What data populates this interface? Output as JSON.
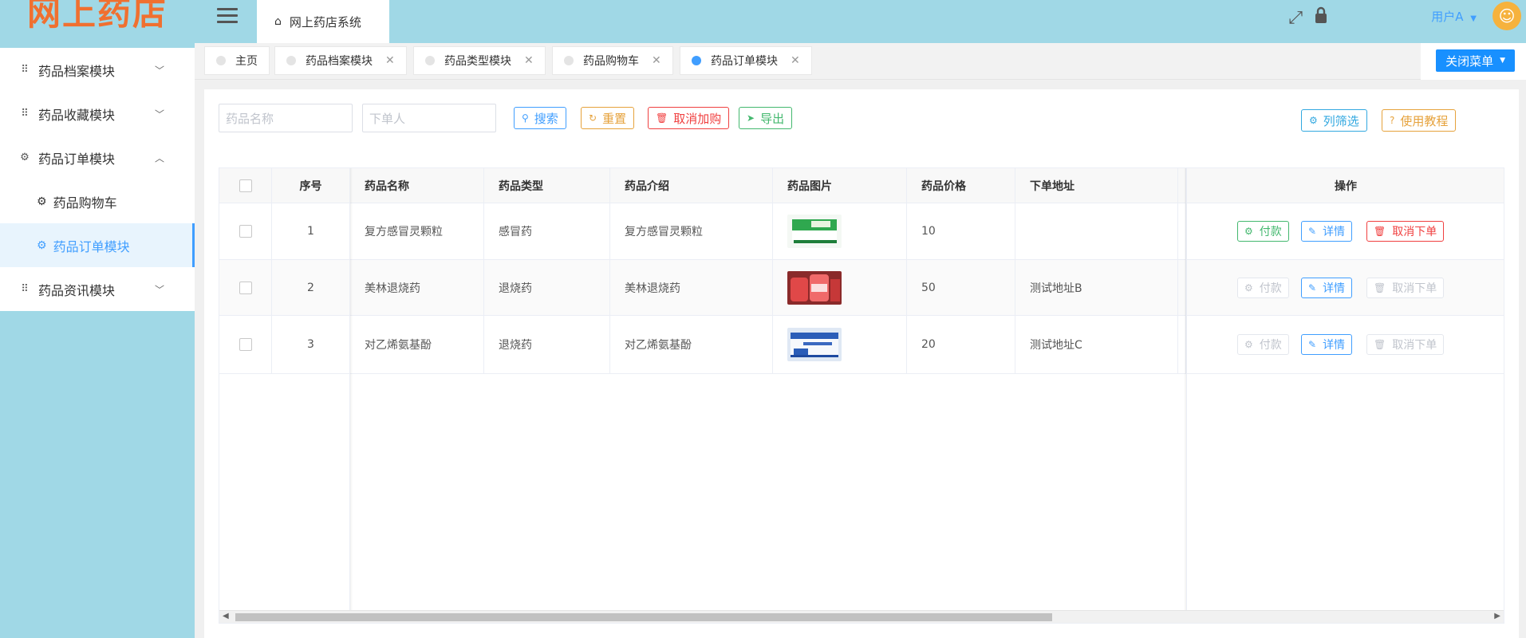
{
  "app": {
    "logo": "网上药店",
    "system_title": "网上药店系统",
    "user": "用户A",
    "close_menu": "关闭菜单"
  },
  "sidebar": {
    "items": [
      {
        "label": "药品档案模块",
        "expanded": false
      },
      {
        "label": "药品收藏模块",
        "expanded": false
      },
      {
        "label": "药品订单模块",
        "expanded": true,
        "children": [
          {
            "label": "药品购物车",
            "active": false
          },
          {
            "label": "药品订单模块",
            "active": true
          }
        ]
      },
      {
        "label": "药品资讯模块",
        "expanded": false
      }
    ]
  },
  "tabs": [
    {
      "label": "主页",
      "active": false,
      "closable": false
    },
    {
      "label": "药品档案模块",
      "active": false,
      "closable": true
    },
    {
      "label": "药品类型模块",
      "active": false,
      "closable": true
    },
    {
      "label": "药品购物车",
      "active": false,
      "closable": true
    },
    {
      "label": "药品订单模块",
      "active": true,
      "closable": true
    }
  ],
  "toolbar": {
    "name_placeholder": "药品名称",
    "orderer_placeholder": "下单人",
    "search": "搜索",
    "reset": "重置",
    "cancel_cart": "取消加购",
    "export": "导出",
    "column_filter": "列筛选",
    "tutorial": "使用教程"
  },
  "table": {
    "headers": {
      "index": "序号",
      "name": "药品名称",
      "type": "药品类型",
      "intro": "药品介绍",
      "image": "药品图片",
      "price": "药品价格",
      "address": "下单地址",
      "ops": "操作"
    },
    "rows": [
      {
        "index": "1",
        "name": "复方感冒灵颗粒",
        "type": "感冒药",
        "intro": "复方感冒灵颗粒",
        "price": "10",
        "address": "",
        "pay_enabled": true,
        "cancel_enabled": true
      },
      {
        "index": "2",
        "name": "美林退烧药",
        "type": "退烧药",
        "intro": "美林退烧药",
        "price": "50",
        "address": "测试地址B",
        "pay_enabled": false,
        "cancel_enabled": false
      },
      {
        "index": "3",
        "name": "对乙烯氨基酚",
        "type": "退烧药",
        "intro": "对乙烯氨基酚",
        "price": "20",
        "address": "测试地址C",
        "pay_enabled": false,
        "cancel_enabled": false
      }
    ],
    "op_labels": {
      "pay": "付款",
      "detail": "详情",
      "cancel": "取消下单"
    }
  },
  "colors": {
    "sidebar_bg": "#a0d8e6",
    "accent": "#409eff",
    "logo": "#f07030"
  }
}
